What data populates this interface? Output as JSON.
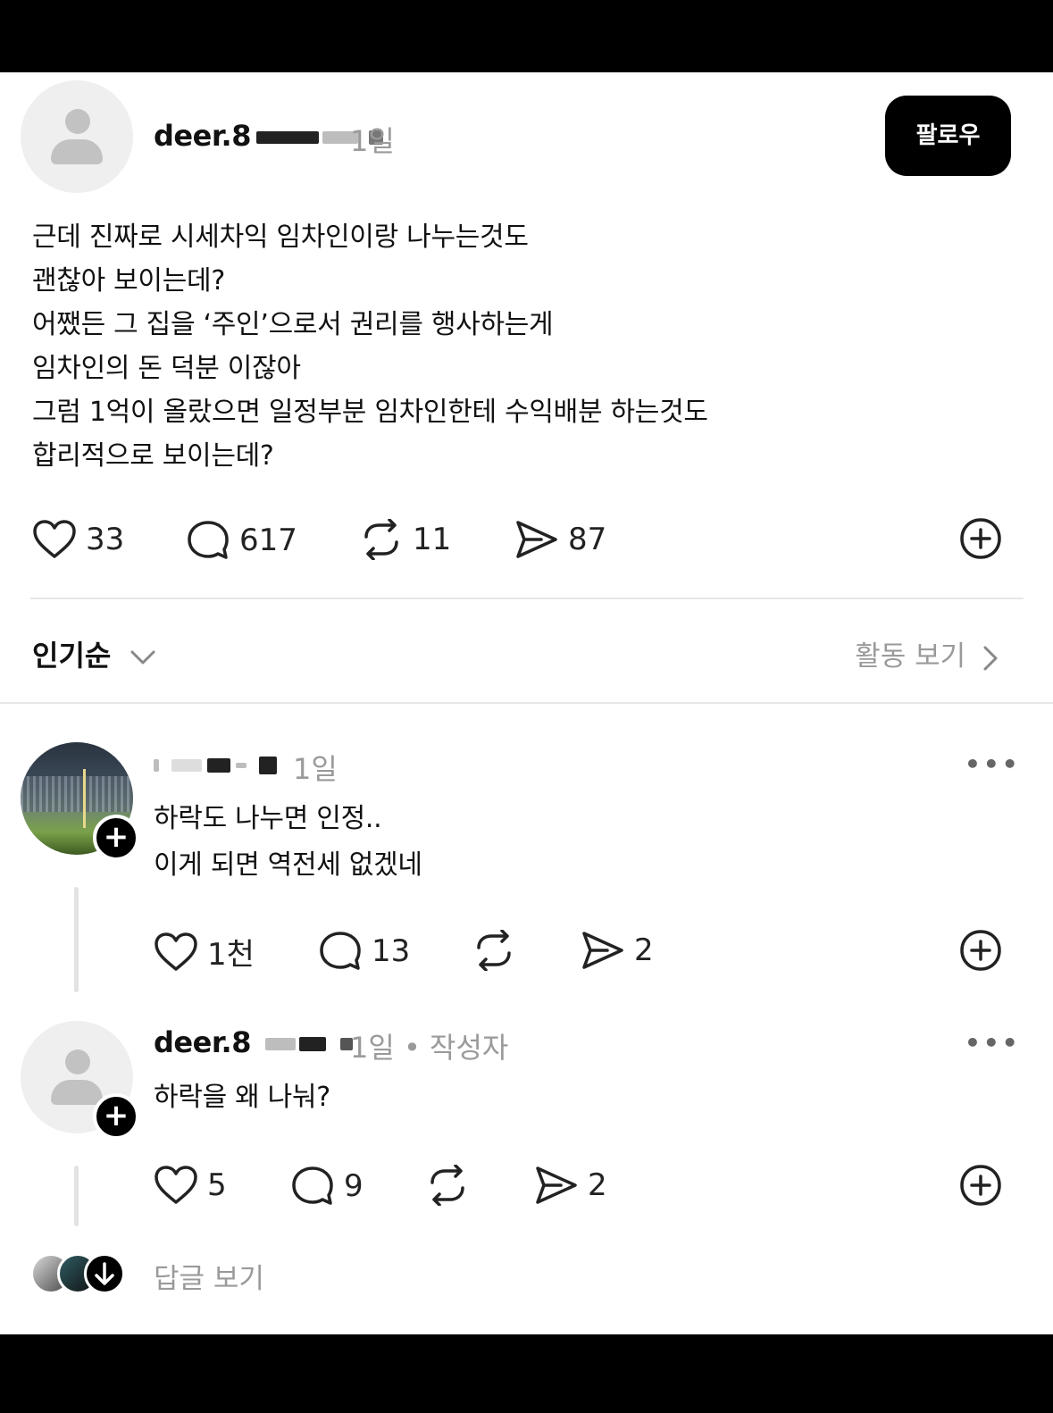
{
  "post": {
    "username_prefix": "deer.8",
    "time": "1일",
    "follow_label": "팔로우",
    "text": "근데 진짜로 시세차익 임차인이랑 나누는것도\n괜찮아 보이는데?\n어쨌든 그 집을 ‘주인’으로서 권리를 행사하는게\n임차인의 돈 덕분 이잖아\n그럼 1억이 올랐으면 일정부분 임차인한테 수익배분 하는것도\n합리적으로 보이는데?",
    "likes": "33",
    "comments": "617",
    "reposts": "11",
    "shares": "87"
  },
  "sortbar": {
    "sort_label": "인기순",
    "activity_label": "활동 보기"
  },
  "comments": [
    {
      "time": "1일",
      "text": "하락도 나누면 인정..\n이게 되면 역전세 없겠네",
      "likes": "1천",
      "replies": "13",
      "shares": "2"
    },
    {
      "username_prefix": "deer.8",
      "time": "1일",
      "author_tag": "• 작성자",
      "text": "하락을 왜 나눠?",
      "likes": "5",
      "replies": "9",
      "shares": "2"
    }
  ],
  "footer": {
    "view_replies_label": "답글 보기"
  }
}
